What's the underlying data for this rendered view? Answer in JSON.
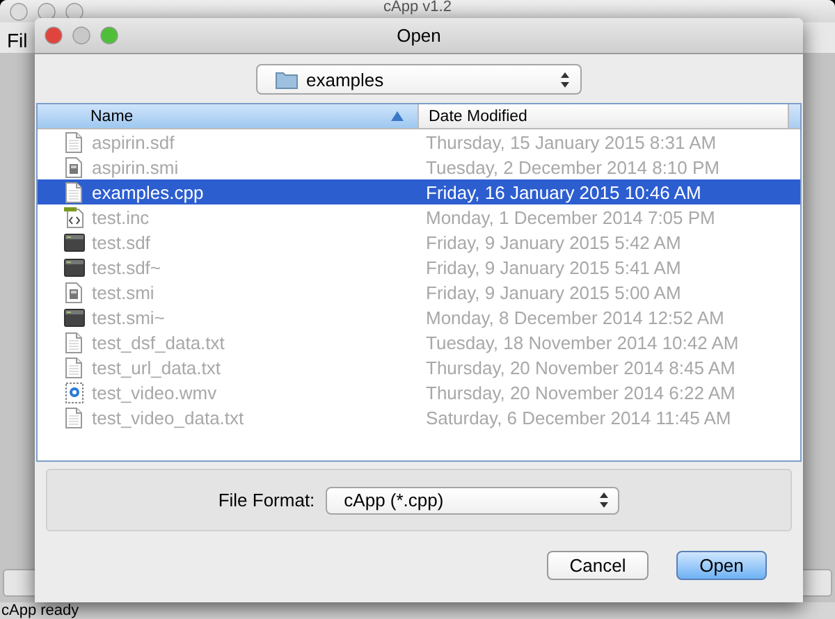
{
  "back_window": {
    "title": "cApp v1.2",
    "menu": "Fil",
    "status": "cApp ready"
  },
  "dialog": {
    "title": "Open",
    "location": "examples",
    "columns": [
      {
        "label": "Name",
        "sorted": true
      },
      {
        "label": "Date Modified",
        "sorted": false
      }
    ],
    "files": [
      {
        "name": "aspirin.sdf",
        "date": "Thursday, 15 January 2015 8:31 AM",
        "kind": "doc",
        "selected": false,
        "disabled": true
      },
      {
        "name": "aspirin.smi",
        "date": "Tuesday, 2 December 2014 8:10 PM",
        "kind": "script",
        "selected": false,
        "disabled": true
      },
      {
        "name": "examples.cpp",
        "date": "Friday, 16 January 2015 10:46 AM",
        "kind": "doc",
        "selected": true,
        "disabled": false
      },
      {
        "name": "test.inc",
        "date": "Monday, 1 December 2014 7:05 PM",
        "kind": "source",
        "selected": false,
        "disabled": true
      },
      {
        "name": "test.sdf",
        "date": "Friday, 9 January 2015 5:42 AM",
        "kind": "terminal",
        "selected": false,
        "disabled": true
      },
      {
        "name": "test.sdf~",
        "date": "Friday, 9 January 2015 5:41 AM",
        "kind": "terminal",
        "selected": false,
        "disabled": true
      },
      {
        "name": "test.smi",
        "date": "Friday, 9 January 2015 5:00 AM",
        "kind": "script",
        "selected": false,
        "disabled": true
      },
      {
        "name": "test.smi~",
        "date": "Monday, 8 December 2014 12:52 AM",
        "kind": "terminal",
        "selected": false,
        "disabled": true
      },
      {
        "name": "test_dsf_data.txt",
        "date": "Tuesday, 18 November 2014 10:42 AM",
        "kind": "doc",
        "selected": false,
        "disabled": true
      },
      {
        "name": "test_url_data.txt",
        "date": "Thursday, 20 November 2014 8:45 AM",
        "kind": "doc",
        "selected": false,
        "disabled": true
      },
      {
        "name": "test_video.wmv",
        "date": "Thursday, 20 November 2014 6:22 AM",
        "kind": "video",
        "selected": false,
        "disabled": true
      },
      {
        "name": "test_video_data.txt",
        "date": "Saturday, 6 December 2014 11:45 AM",
        "kind": "doc",
        "selected": false,
        "disabled": true
      }
    ],
    "format_label": "File Format:",
    "format": "cApp (*.cpp)",
    "buttons": [
      {
        "label": "Cancel",
        "default": false
      },
      {
        "label": "Open",
        "default": true
      }
    ]
  }
}
